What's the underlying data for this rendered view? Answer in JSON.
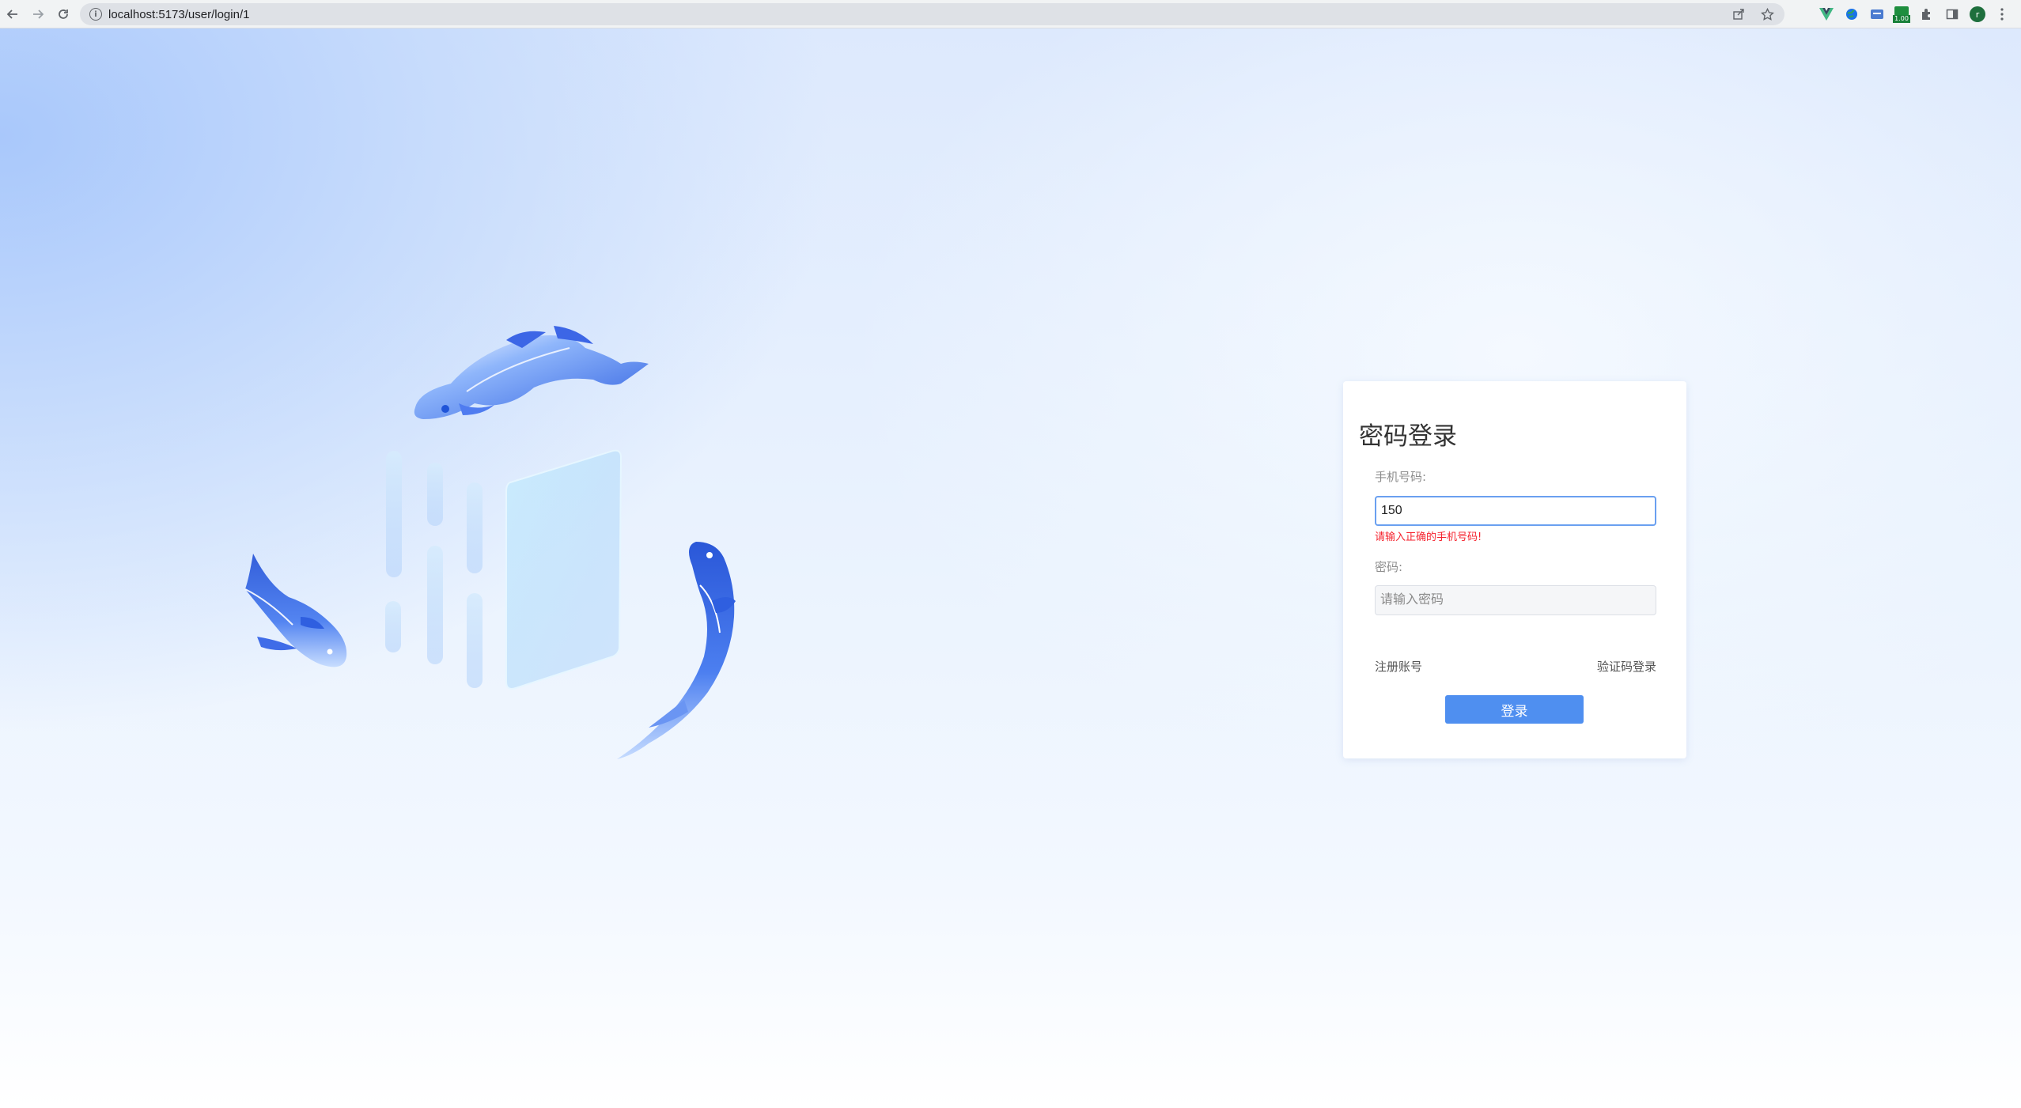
{
  "browser": {
    "url": "localhost:5173/user/login/1",
    "extension_badge": "1.00"
  },
  "login": {
    "title": "密码登录",
    "phone_label": "手机号码:",
    "phone_value": "150",
    "phone_error": "请输入正确的手机号码!",
    "password_label": "密码:",
    "password_placeholder": "请输入密码",
    "register_link": "注册账号",
    "sms_login_link": "验证码登录",
    "submit_label": "登录"
  },
  "colors": {
    "primary": "#4f8ff0",
    "error": "#f5222d",
    "focus_border": "#6aa0f0"
  }
}
